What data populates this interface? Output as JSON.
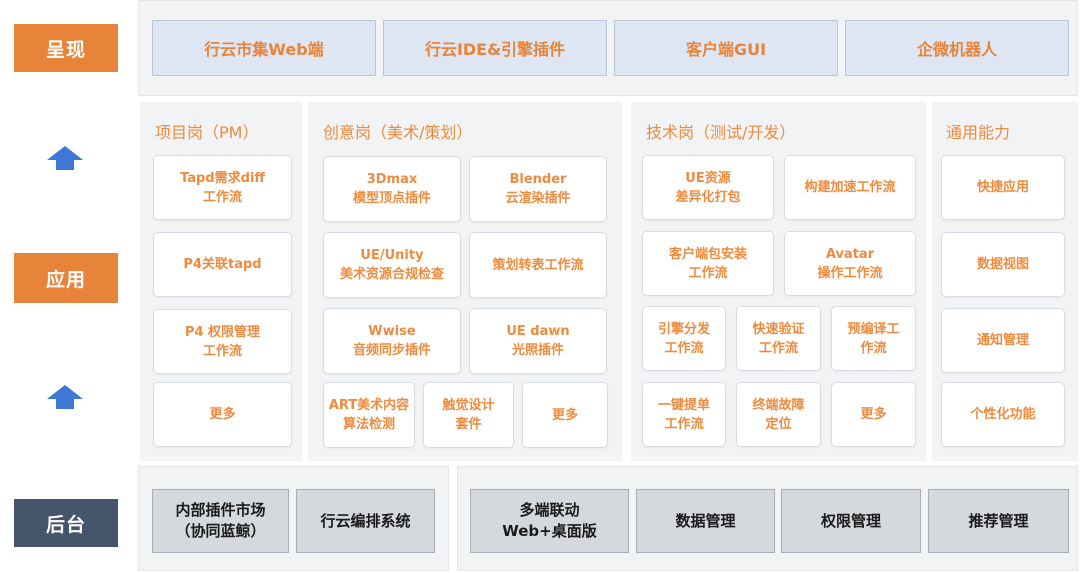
{
  "layers": {
    "presentation": "呈现",
    "application": "应用",
    "backend": "后台"
  },
  "presentation_items": [
    "行云市集Web端",
    "行云IDE&引擎插件",
    "客户端GUI",
    "企微机器人"
  ],
  "panels": {
    "pm": {
      "title": "项目岗（PM）",
      "cards": [
        "Tapd需求diff\n工作流",
        "P4关联tapd",
        "P4 权限管理\n工作流",
        "更多"
      ]
    },
    "creative": {
      "title": "创意岗（美术/策划）",
      "cards": [
        "3Dmax\n模型顶点插件",
        "Blender\n云渲染插件",
        "UE/Unity\n美术资源合规检查",
        "策划转表工作流",
        "Wwise\n音频同步插件",
        "UE dawn\n光照插件",
        "ART美术内容\n算法检测",
        "触觉设计\n套件",
        "更多"
      ]
    },
    "tech": {
      "title": "技术岗（测试/开发）",
      "cards": [
        "UE资源\n差异化打包",
        "构建加速工作流",
        "客户端包安装\n工作流",
        "Avatar\n操作工作流",
        "引擎分发\n工作流",
        "快速验证\n工作流",
        "预编译工\n作流",
        "一键提单\n工作流",
        "终端故障\n定位",
        "更多"
      ]
    },
    "common": {
      "title": "通用能力",
      "cards": [
        "快捷应用",
        "数据视图",
        "通知管理",
        "个性化功能"
      ]
    }
  },
  "backend_items": [
    "内部插件市场\n（协同蓝鲸）",
    "行云编排系统",
    "多端联动\nWeb+桌面版",
    "数据管理",
    "权限管理",
    "推荐管理"
  ],
  "colors": {
    "accent_orange": "#e8833a",
    "navy": "#44546a",
    "arrow_blue": "#3f77d6"
  },
  "icons": [
    "arrow-up-icon"
  ]
}
